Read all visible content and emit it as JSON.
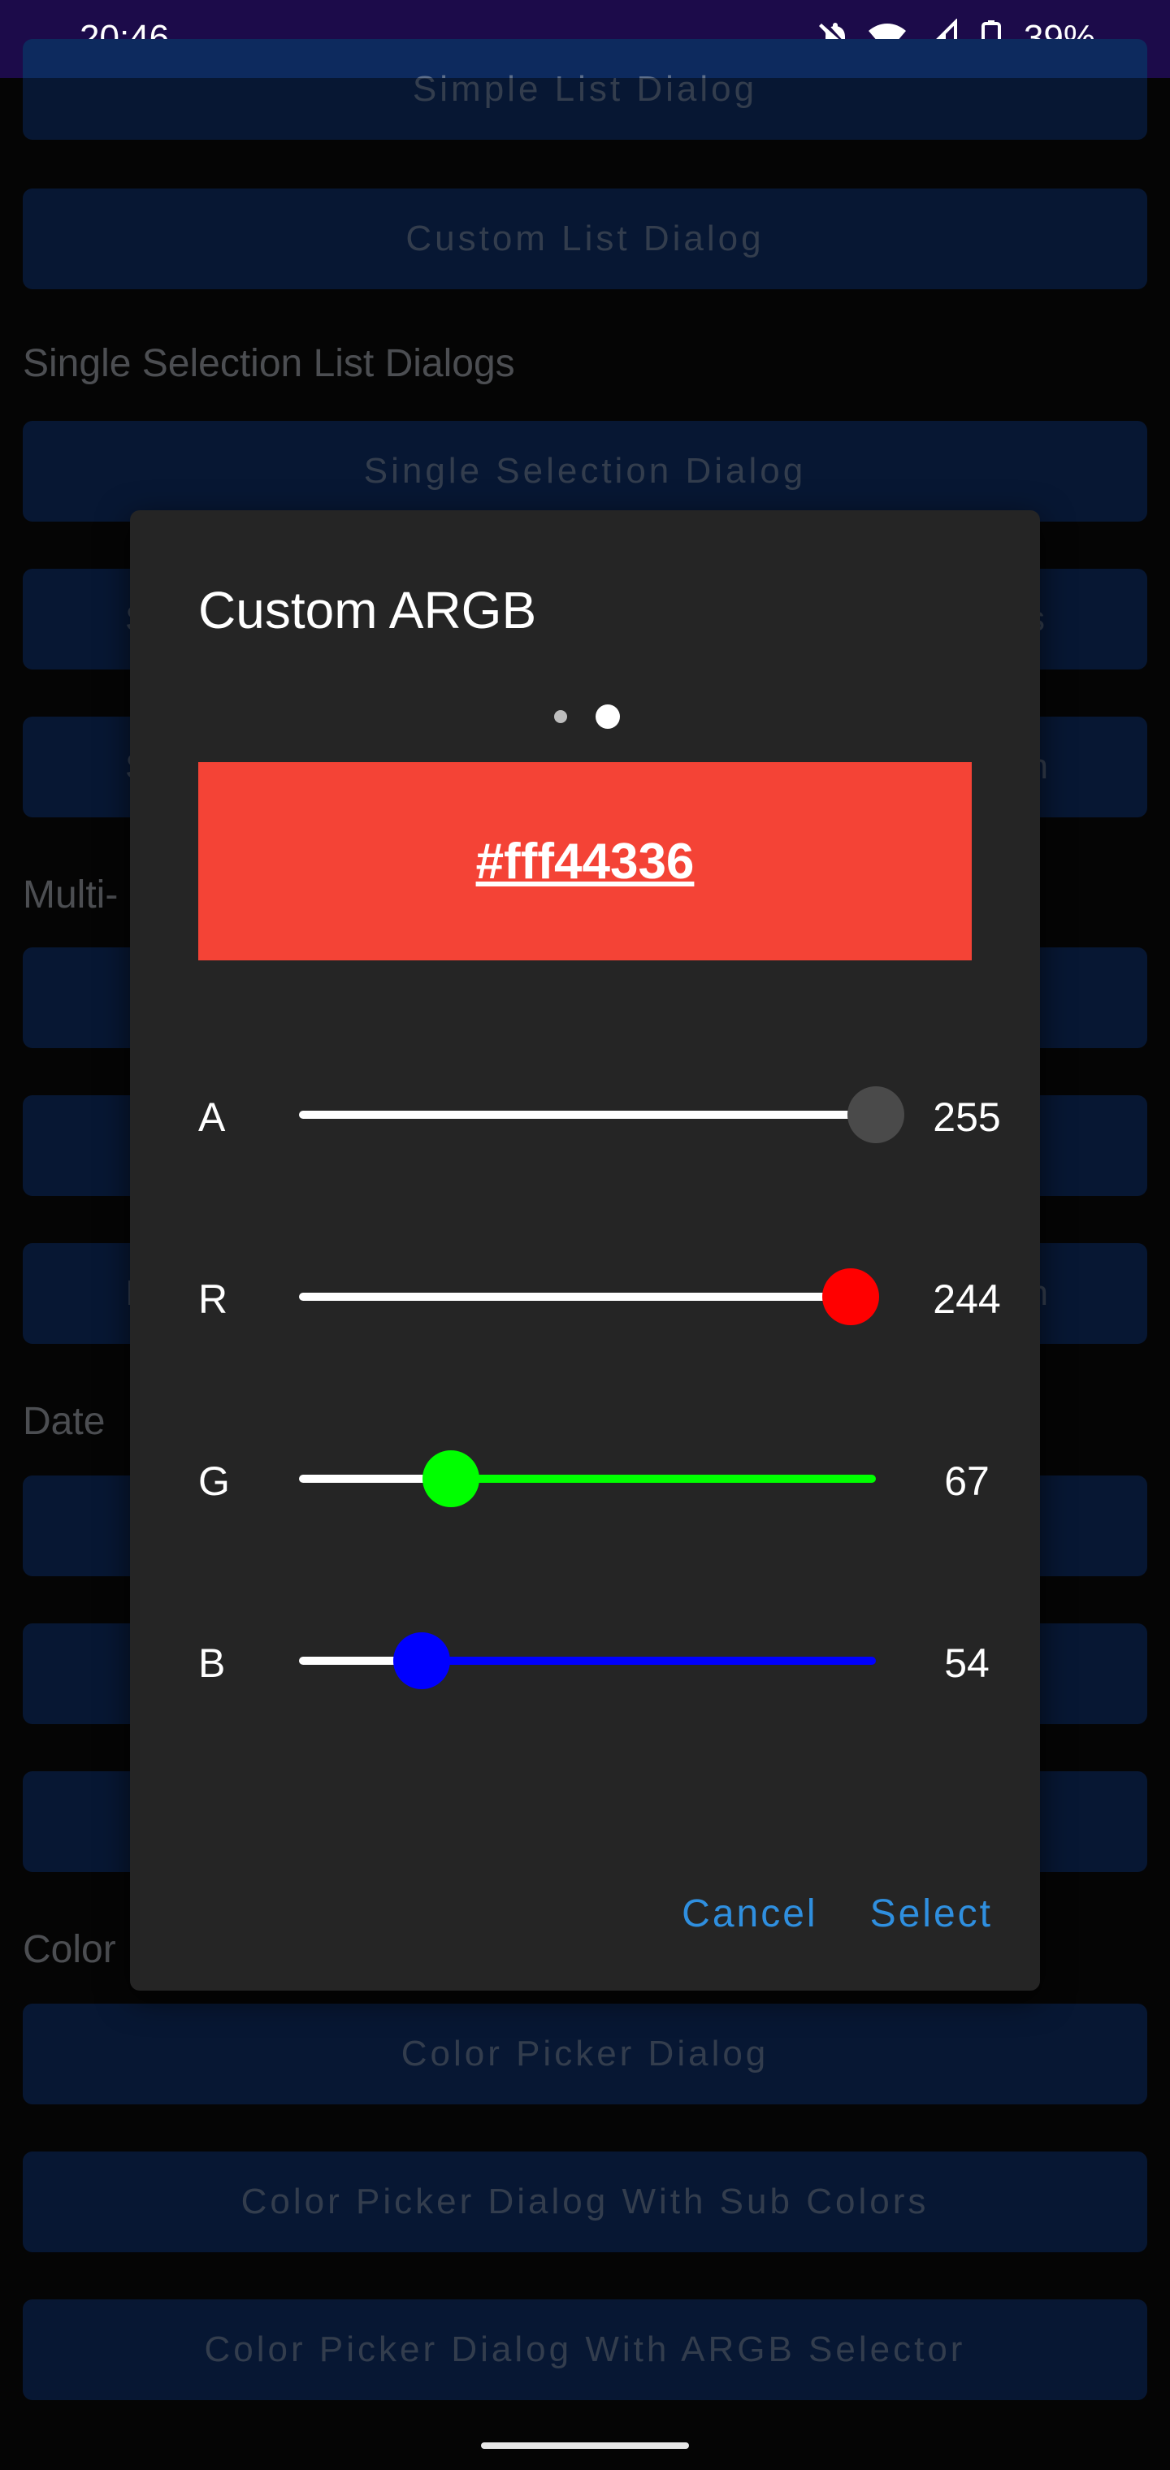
{
  "status_bar": {
    "time": "20:46",
    "battery": "39%",
    "icons": [
      "bell-off-icon",
      "wifi-icon",
      "signal-icon",
      "battery-icon"
    ]
  },
  "background": {
    "buttons_top": [
      {
        "label": "Simple List Dialog"
      },
      {
        "label": "Custom List Dialog"
      }
    ],
    "section_single": "Single Selection List Dialogs",
    "btn_single": "Single Selection Dialog",
    "partial_texts": {
      "row2_left": "S",
      "row2_right": "s",
      "row3_left": "S",
      "row3_right": "n",
      "section_multi": "Multi-",
      "row_e_left": "I",
      "row_e_right": "n",
      "section_date": "Date",
      "section_color": "Color"
    },
    "color_buttons": [
      {
        "label": "Color Picker Dialog"
      },
      {
        "label": "Color Picker Dialog With Sub Colors"
      },
      {
        "label": "Color Picker Dialog With ARGB Selector"
      }
    ]
  },
  "dialog": {
    "title": "Custom ARGB",
    "pages": 2,
    "current_page": 2,
    "preview": {
      "hex": "#fff44336",
      "color": "#f44336"
    },
    "channels": [
      {
        "label": "A",
        "value": "255",
        "fraction": 1.0,
        "thumb_color": "#4a4a4a",
        "active_color": "#ffffff",
        "inactive_color": "#ffffff"
      },
      {
        "label": "R",
        "value": "244",
        "fraction": 0.957,
        "thumb_color": "#ff0000",
        "active_color": "#ffffff",
        "inactive_color": "#ffffff"
      },
      {
        "label": "G",
        "value": "67",
        "fraction": 0.263,
        "thumb_color": "#00ff00",
        "active_color": "#ffffff",
        "inactive_color": "#00ff00"
      },
      {
        "label": "B",
        "value": "54",
        "fraction": 0.212,
        "thumb_color": "#0000ff",
        "active_color": "#ffffff",
        "inactive_color": "#0000ff"
      }
    ],
    "cancel_label": "Cancel",
    "select_label": "Select"
  }
}
